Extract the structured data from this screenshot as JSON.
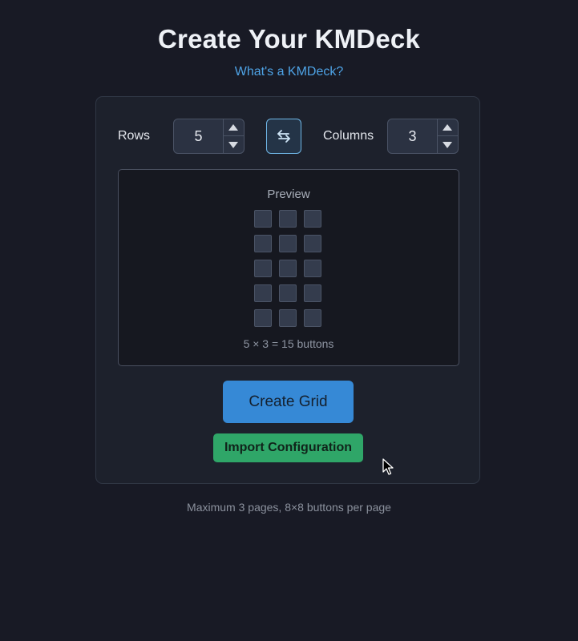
{
  "header": {
    "title": "Create Your KMDeck",
    "help_link": "What's a KMDeck?"
  },
  "grid_config": {
    "rows_label": "Rows",
    "rows_value": "5",
    "columns_label": "Columns",
    "columns_value": "3",
    "swap_icon": "swap-arrows-icon"
  },
  "preview": {
    "title": "Preview",
    "rows": 5,
    "columns": 3,
    "caption": "5 × 3 = 15 buttons"
  },
  "actions": {
    "create_label": "Create Grid",
    "import_label": "Import Configuration"
  },
  "footer": {
    "note": "Maximum 3 pages, 8×8 buttons per page"
  },
  "colors": {
    "background": "#181a25",
    "card": "#1d212c",
    "link": "#4ea3e6",
    "primary_button": "#3689d6",
    "secondary_button": "#2fa668",
    "swap_border": "#6fb6e6"
  }
}
